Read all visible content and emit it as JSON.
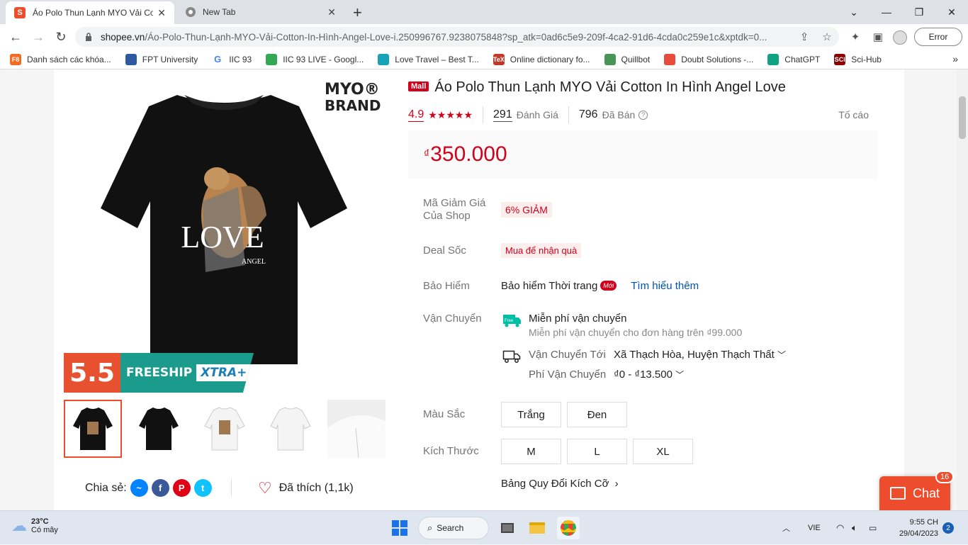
{
  "browser": {
    "tabs": [
      {
        "title": "Áo Polo Thun Lạnh MYO Vải Cotton In Hình Angel Love",
        "active": true,
        "favicon": "shopee-icon"
      },
      {
        "title": "New Tab",
        "active": false,
        "favicon": "chrome-icon"
      }
    ],
    "url_host": "shopee.vn",
    "url_path": "/Áo-Polo-Thun-Lạnh-MYO-Vải-Cotton-In-Hình-Angel-Love-i.250996767.9238075848?sp_atk=0ad6c5e9-209f-4ca2-91d6-4cda0c259e1c&xptdk=0...",
    "error_label": "Error",
    "bookmarks": [
      {
        "label": "Danh sách các khóa...",
        "color": "#f26b21",
        "glyph": "F8"
      },
      {
        "label": "FPT University",
        "color": "#2c5aa0",
        "glyph": ""
      },
      {
        "label": "IIC 93",
        "color": "#ffffff",
        "glyph": "G"
      },
      {
        "label": "IIC 93 LIVE - Googl...",
        "color": "#34a853",
        "glyph": ""
      },
      {
        "label": "Love Travel – Best T...",
        "color": "#17a2b8",
        "glyph": ""
      },
      {
        "label": "Online dictionary fo...",
        "color": "#c0392b",
        "glyph": "TeX"
      },
      {
        "label": "Quillbot",
        "color": "#499557",
        "glyph": ""
      },
      {
        "label": "Doubt Solutions -...",
        "color": "#e74c3c",
        "glyph": ""
      },
      {
        "label": "ChatGPT",
        "color": "#10a37f",
        "glyph": ""
      },
      {
        "label": "Sci-Hub",
        "color": "#8b0000",
        "glyph": "SCI"
      }
    ]
  },
  "product": {
    "brand_mark_line1": "MYO®",
    "brand_mark_line2": "BRAND",
    "mall_badge": "Mall",
    "title": "Áo Polo Thun Lạnh MYO Vải Cotton In Hình Angel Love",
    "rating": "4.9",
    "rating_count": "291",
    "rating_label": "Đánh Giá",
    "sold_count": "796",
    "sold_label": "Đã Bán",
    "report": "Tố cáo",
    "price_currency": "₫",
    "price": "350.000",
    "shirt_print_text": "LOVE",
    "shirt_print_sub": "ANGEL",
    "promo_number": "5.5",
    "promo_freeship": "FREESHIP",
    "promo_xtra": "XTRA+",
    "share_label": "Chia sẻ:",
    "liked_label": "Đã thích (1,1k)"
  },
  "details": {
    "voucher_label_1": "Mã Giảm Giá",
    "voucher_label_2": "Của Shop",
    "voucher_value": "6% GIẢM",
    "deal_label": "Deal Sốc",
    "deal_value": "Mua để nhận quà",
    "insurance_label": "Bảo Hiểm",
    "insurance_value": "Bảo hiểm Thời trang",
    "insurance_new": "Mới",
    "insurance_link": "Tìm hiểu thêm",
    "shipping_label": "Vận Chuyển",
    "free_ship_title": "Miễn phí vận chuyển",
    "free_ship_sub": "Miễn phí vận chuyển cho đơn hàng trên ₫99.000",
    "ship_to_label": "Vận Chuyển Tới",
    "ship_to_value": "Xã Thạch Hòa, Huyện Thạch Thất",
    "ship_fee_label": "Phí Vận Chuyển",
    "ship_fee_value": "₫0 - ₫13.500",
    "color_label": "Màu Sắc",
    "colors": [
      "Trắng",
      "Đen"
    ],
    "size_label": "Kích Thước",
    "sizes": [
      "M",
      "L",
      "XL"
    ],
    "size_chart": "Bảng Quy Đổi Kích Cỡ"
  },
  "chat": {
    "label": "Chat",
    "badge": "16",
    "color": "#ee4d2d"
  },
  "taskbar": {
    "temp": "23°C",
    "weather": "Có mây",
    "search": "Search",
    "lang": "VIE",
    "time": "9:55 CH",
    "date": "29/04/2023",
    "notifications": "2"
  },
  "colors": {
    "accent": "#d0011b",
    "shopee_orange": "#ee4d2d",
    "link": "#0055aa"
  }
}
